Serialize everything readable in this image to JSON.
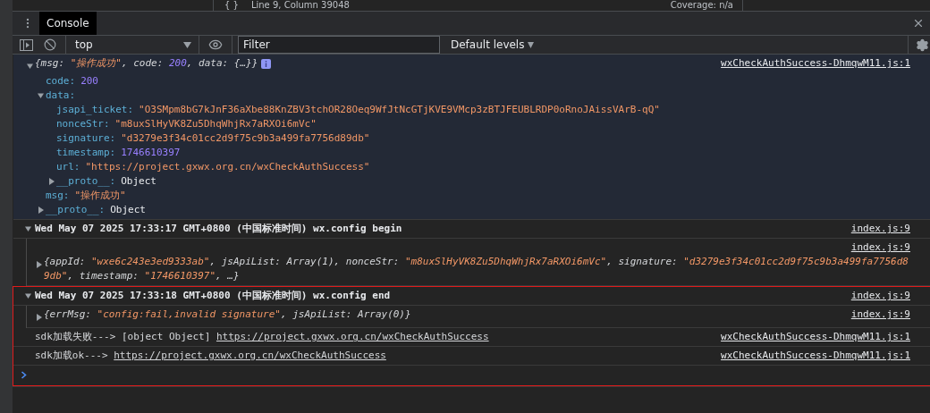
{
  "editor_status": {
    "icon": "{ }",
    "position": "Line 9, Column 39048",
    "coverage": "Coverage: n/a"
  },
  "drawer": {
    "tabs": [
      {
        "label": "Console",
        "selected": true
      }
    ]
  },
  "toolbar": {
    "context": "top",
    "filter": {
      "placeholder": "Filter"
    },
    "levels": "Default levels"
  },
  "messages": [
    {
      "kind": "object",
      "selected": true,
      "framed": false,
      "expanded": true,
      "source": "wxCheckAuthSuccess-DhmqwM11.js:1",
      "summary": [
        {
          "kind": "text",
          "text": "{msg: "
        },
        {
          "kind": "string",
          "text": "\"操作成功\""
        },
        {
          "kind": "text",
          "text": ", code: "
        },
        {
          "kind": "number",
          "text": "200"
        },
        {
          "kind": "text",
          "text": ", data: {…}}"
        }
      ],
      "properties": [
        {
          "key": "code:",
          "value": "200",
          "kind": "number"
        },
        {
          "key": "data:",
          "expanded": true,
          "children": [
            {
              "key": "jsapi_ticket:",
              "value": "\"O3SMpm8bG7kJnF36aXbe88KnZBV3tchOR28Oeq9WfJtNcGTjKVE9VMcp3zBTJFEUBLRDP0oRnoJAissVArB-qQ\"",
              "kind": "string"
            },
            {
              "key": "nonceStr:",
              "value": "\"m8uxSlHyVK8Zu5DhqWhjRx7aRXOi6mVc\"",
              "kind": "string"
            },
            {
              "key": "signature:",
              "value": "\"d3279e3f34c01cc2d9f75c9b3a499fa7756d89db\"",
              "kind": "string"
            },
            {
              "key": "timestamp:",
              "value": "1746610397",
              "kind": "number"
            },
            {
              "key": "url:",
              "value": "\"https://project.gxwx.org.cn/wxCheckAuthSuccess\"",
              "kind": "string"
            },
            {
              "key": "__proto__:",
              "value": "Object",
              "kind": "object",
              "expanded": false
            }
          ]
        },
        {
          "key": "msg:",
          "value": "\"操作成功\"",
          "kind": "string"
        },
        {
          "key": "__proto__:",
          "value": "Object",
          "kind": "object",
          "expanded": false
        }
      ]
    },
    {
      "kind": "group",
      "selected": false,
      "framed": false,
      "expanded": true,
      "title": "Wed May 07 2025 17:33:17 GMT+0800 (中国标准时间) wx.config begin",
      "source": "index.js:9",
      "children": [
        {
          "kind": "object",
          "expanded": false,
          "source": "index.js:9",
          "summary": [
            {
              "kind": "text",
              "text": "{appId: "
            },
            {
              "kind": "string",
              "text": "\"wxe6c243e3ed9333ab\""
            },
            {
              "kind": "text",
              "text": ", jsApiList: Array(1), nonceStr: "
            },
            {
              "kind": "string",
              "text": "\"m8uxSlHyVK8Zu5DhqWhjRx7aRXOi6mVc\""
            },
            {
              "kind": "text",
              "text": ", signature: "
            },
            {
              "kind": "string",
              "text": "\"d3279e3f34c01cc2d9f75c9b3a499fa7756d89db\""
            },
            {
              "kind": "text",
              "text": ", timestamp: "
            },
            {
              "kind": "string",
              "text": "\"1746610397\""
            },
            {
              "kind": "text",
              "text": ", …}"
            }
          ]
        }
      ]
    },
    {
      "kind": "group",
      "selected": false,
      "framed": true,
      "expanded": true,
      "title": "Wed May 07 2025 17:33:18 GMT+0800 (中国标准时间) wx.config end",
      "source": "index.js:9",
      "children": [
        {
          "kind": "object",
          "expanded": false,
          "source": "index.js:9",
          "summary": [
            {
              "kind": "text",
              "text": "{errMsg: "
            },
            {
              "kind": "string",
              "text": "\"config:fail,invalid signature\""
            },
            {
              "kind": "text",
              "text": ", jsApiList: Array(0)}"
            }
          ]
        }
      ]
    },
    {
      "kind": "log",
      "selected": false,
      "framed": true,
      "source": "wxCheckAuthSuccess-DhmqwM11.js:1",
      "parts": [
        {
          "kind": "text",
          "text": "sdk加载失败---> [object Object] "
        },
        {
          "kind": "link",
          "text": "https://project.gxwx.org.cn/wxCheckAuthSuccess"
        }
      ]
    },
    {
      "kind": "log",
      "selected": false,
      "framed": true,
      "source": "wxCheckAuthSuccess-DhmqwM11.js:1",
      "parts": [
        {
          "kind": "text",
          "text": "sdk加载ok---> "
        },
        {
          "kind": "link",
          "text": "https://project.gxwx.org.cn/wxCheckAuthSuccess"
        }
      ]
    }
  ],
  "prompt": {
    "framed": true
  }
}
